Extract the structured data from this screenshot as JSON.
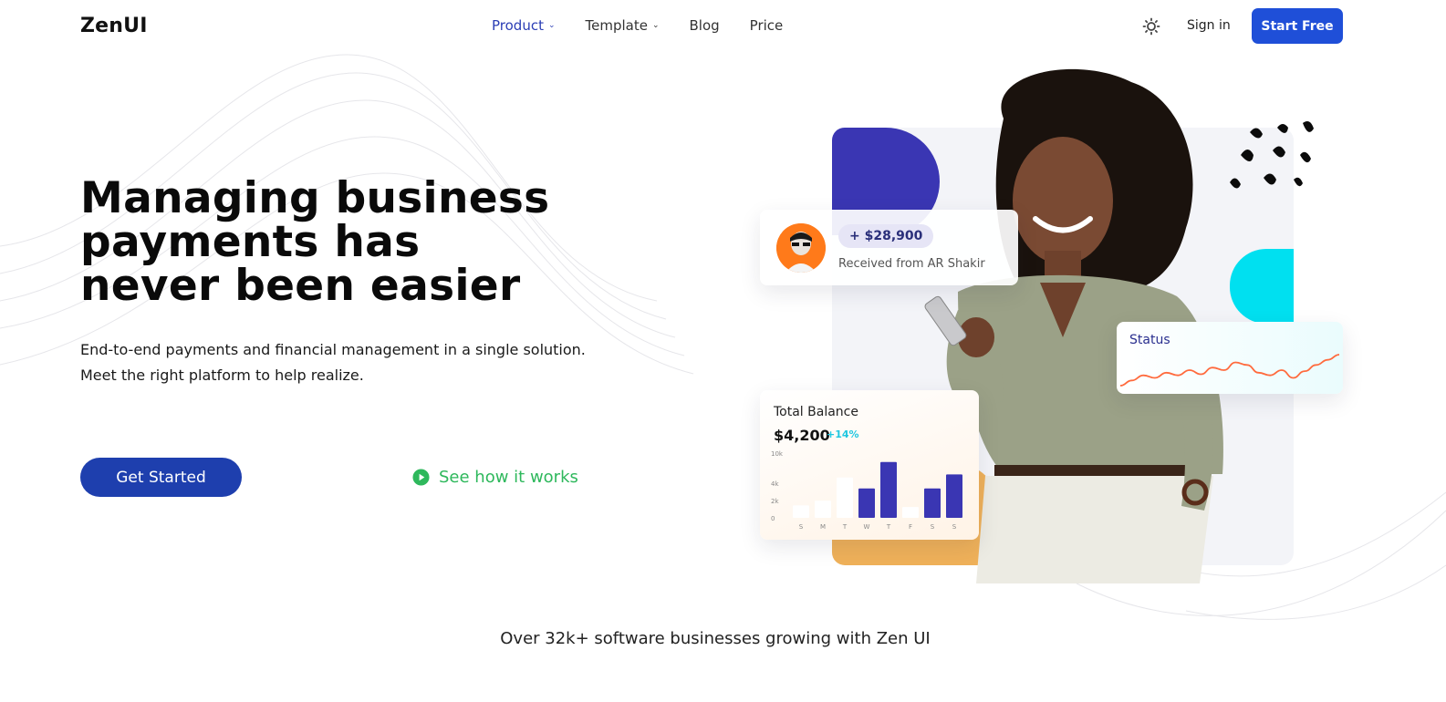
{
  "nav": {
    "logo": "ZenUI",
    "links": [
      {
        "label": "Product",
        "has_caret": true,
        "active": true
      },
      {
        "label": "Template",
        "has_caret": true,
        "active": false
      },
      {
        "label": "Blog",
        "has_caret": false,
        "active": false
      },
      {
        "label": "Price",
        "has_caret": false,
        "active": false
      }
    ],
    "theme_icon": "sun-icon",
    "sign_in": "Sign in",
    "start_free": "Start Free"
  },
  "hero": {
    "title": "Managing business payments has never been easier",
    "subtitle_line1": "End-to-end payments and financial management in a single solution.",
    "subtitle_line2": "Meet the right platform to help realize.",
    "primary_cta": "Get Started",
    "secondary_cta": "See how it works"
  },
  "cards": {
    "received": {
      "amount": "+ $28,900",
      "text": "Received from AR Shakir"
    },
    "status": {
      "label": "Status"
    },
    "balance": {
      "label": "Total Balance",
      "value": "$4,200",
      "change": "+14%"
    }
  },
  "chart_data": [
    {
      "type": "bar",
      "title": "Total Balance",
      "categories": [
        "S",
        "M",
        "T",
        "W",
        "T",
        "F",
        "S",
        "S"
      ],
      "y_tick_labels": [
        "0",
        "2k",
        "4k",
        "10k"
      ],
      "series": [
        {
          "values": [
            0.8,
            1.1,
            2.6,
            1.9,
            3.6,
            0.7,
            1.9,
            2.8
          ]
        }
      ],
      "highlighted": [
        false,
        false,
        false,
        true,
        true,
        false,
        true,
        true
      ],
      "colors": {
        "highlight": "#3a36b3",
        "base": "#ffffff"
      }
    },
    {
      "type": "line",
      "title": "Status",
      "series": [
        {
          "values": [
            2,
            3,
            4,
            3.5,
            4.5,
            4,
            5,
            4.2,
            5.5,
            5,
            6.5,
            6,
            4.5,
            4,
            5,
            3.5,
            4.8,
            6,
            7,
            8
          ]
        }
      ],
      "grid": false,
      "colors": {
        "line": "#ff6a3d"
      }
    }
  ],
  "trust": {
    "text": "Over 32k+ software businesses growing with Zen UI"
  },
  "colors": {
    "primary": "#1f4fd8",
    "primary_dark": "#1e3fae",
    "nav_active": "#2b3eb5",
    "success": "#2eb85c",
    "accent_cyan": "#00e0f0",
    "accent_orange": "#efb15a",
    "accent_indigo": "#3a36b3"
  }
}
